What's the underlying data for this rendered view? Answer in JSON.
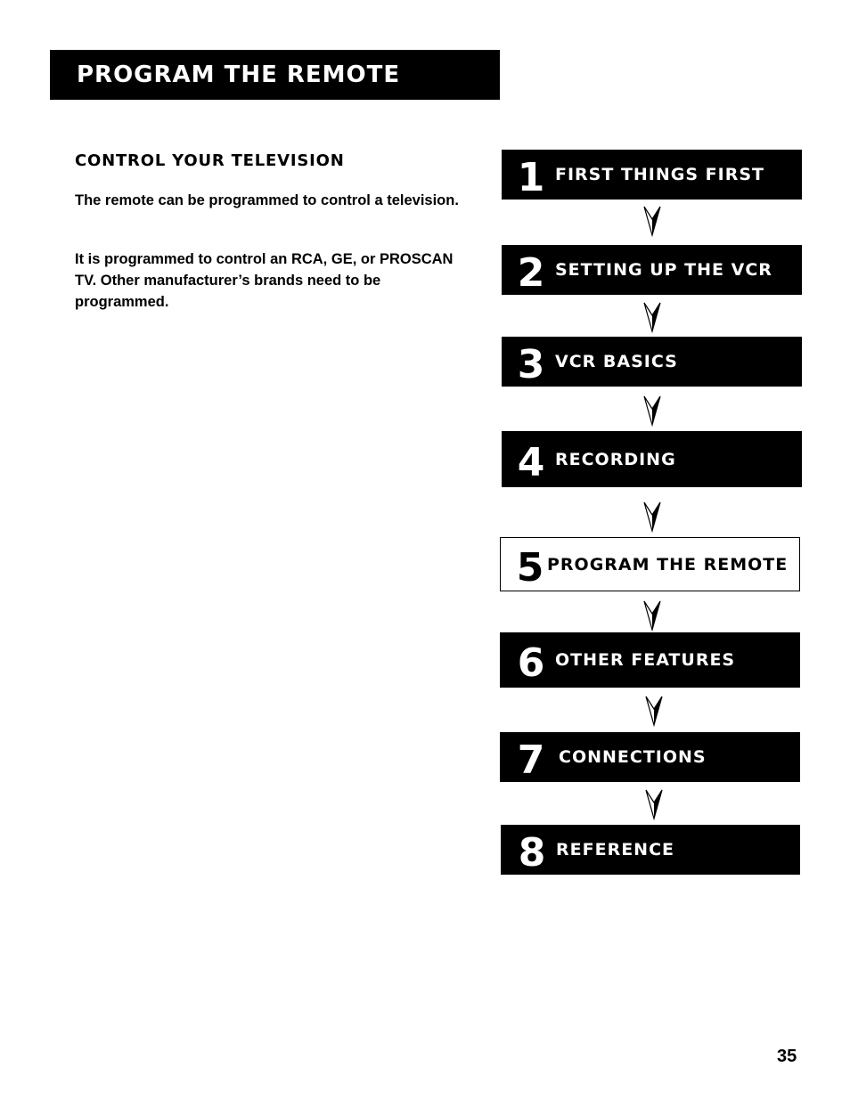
{
  "header": {
    "title": "Program the Remote"
  },
  "section": {
    "heading": "Control Your Television",
    "paragraphs": [
      "The remote can be programmed to control a television.",
      "It is programmed to control an RCA, GE, or PROSCAN TV. Other manufacturer’s brands need to be programmed."
    ]
  },
  "steps": [
    {
      "number": "1",
      "label": "First Things First",
      "current": false
    },
    {
      "number": "2",
      "label": "Setting Up the VCR",
      "current": false
    },
    {
      "number": "3",
      "label": "VCR Basics",
      "current": false
    },
    {
      "number": "4",
      "label": "Recording",
      "current": false
    },
    {
      "number": "5",
      "label": "Program the Remote",
      "current": true
    },
    {
      "number": "6",
      "label": "Other Features",
      "current": false
    },
    {
      "number": "7",
      "label": "Connections",
      "current": false
    },
    {
      "number": "8",
      "label": "Reference",
      "current": false
    }
  ],
  "arrow_icon": "down-arrowhead-icon",
  "footer": {
    "page_number": "35"
  }
}
